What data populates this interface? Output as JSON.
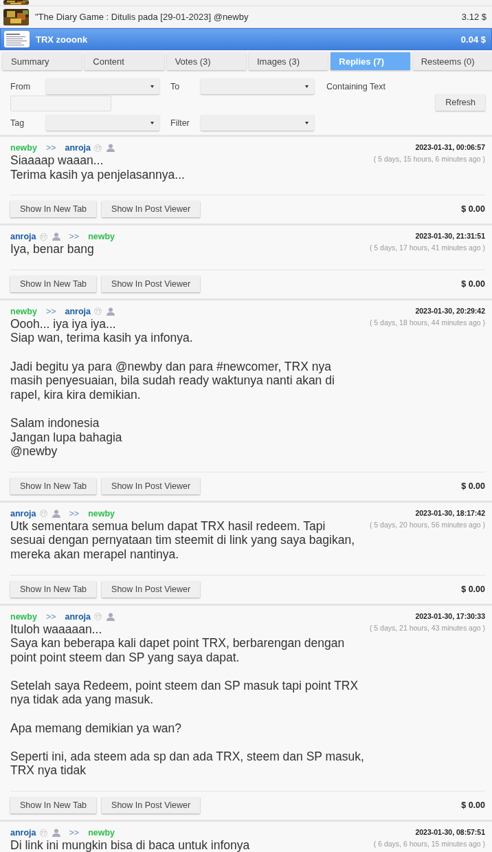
{
  "posts": [
    {
      "selected": false
    },
    {
      "title": "\"The Diary Game : Ditulis pada [29-01-2023] @newby",
      "value": "3.12 $",
      "selected": false
    },
    {
      "title": "TRX zooonk",
      "value": "0.04 $",
      "selected": true
    }
  ],
  "tabs": [
    {
      "label": "Summary",
      "selected": false
    },
    {
      "label": "Content",
      "selected": false
    },
    {
      "label": "Votes (3)",
      "selected": false
    },
    {
      "label": "Images (3)",
      "selected": false
    },
    {
      "label": "Replies (7)",
      "selected": true
    },
    {
      "label": "Resteems (0)",
      "selected": false
    }
  ],
  "filters": {
    "from_label": "From",
    "to_label": "To",
    "text_label": "Containing Text",
    "refresh": "Refresh",
    "tag_label": "Tag",
    "filter_label": "Filter"
  },
  "replies": [
    {
      "from": {
        "name": "newby",
        "color": "#2ebc4f"
      },
      "arrow": ">>",
      "to": {
        "name": "anroja",
        "color": "#1a5ba6",
        "reputation": "77"
      },
      "date": "2023-01-31, 00:06:57",
      "ago": "( 5 days, 15 hours, 6 minutes ago )",
      "body": "Siaaaap waaan...\nTerima kasih ya penjelasannya...",
      "buttons": [
        "Show In New Tab",
        "Show In Post Viewer"
      ],
      "value": "$ 0.00"
    },
    {
      "from": {
        "name": "anroja",
        "color": "#1a5ba6",
        "reputation": "77"
      },
      "arrow": ">>",
      "to": {
        "name": "newby",
        "color": "#2ebc4f"
      },
      "date": "2023-01-30, 21:31:51",
      "ago": "( 5 days, 17 hours, 41 minutes ago )",
      "body": "Iya, benar bang",
      "buttons": [
        "Show In New Tab",
        "Show In Post Viewer"
      ],
      "value": "$ 0.00"
    },
    {
      "from": {
        "name": "newby",
        "color": "#2ebc4f"
      },
      "arrow": ">>",
      "to": {
        "name": "anroja",
        "color": "#1a5ba6",
        "reputation": "77"
      },
      "date": "2023-01-30, 20:29:42",
      "ago": "( 5 days, 18 hours, 44 minutes ago )",
      "body": "Oooh... iya iya iya...\nSiap wan, terima kasih ya infonya.\n\nJadi begitu ya para @newby dan para #newcomer, TRX nya\nmasih penyesuaian, bila sudah ready waktunya nanti akan di\nrapel, kira kira demikian.\n\nSalam indonesia\nJangan lupa bahagia\n@newby",
      "buttons": [
        "Show In New Tab",
        "Show In Post Viewer"
      ],
      "value": "$ 0.00"
    },
    {
      "from": {
        "name": "anroja",
        "color": "#1a5ba6",
        "reputation": "77"
      },
      "arrow": ">>",
      "to": {
        "name": "newby",
        "color": "#2ebc4f"
      },
      "date": "2023-01-30, 18:17:42",
      "ago": "( 5 days, 20 hours, 56 minutes ago )",
      "body": "Utk sementara semua belum dapat TRX hasil redeem. Tapi\nsesuai dengan pernyataan tim steemit di link yang saya bagikan,\nmereka akan merapel nantinya.",
      "buttons": [
        "Show In New Tab",
        "Show In Post Viewer"
      ],
      "value": "$ 0.00"
    },
    {
      "from": {
        "name": "newby",
        "color": "#2ebc4f"
      },
      "arrow": ">>",
      "to": {
        "name": "anroja",
        "color": "#1a5ba6",
        "reputation": "77"
      },
      "date": "2023-01-30, 17:30:33",
      "ago": "( 5 days, 21 hours, 43 minutes ago )",
      "body": "Ituloh waaaaan...\nSaya kan beberapa kali dapet point TRX, berbarengan dengan\npoint point steem dan SP yang saya dapat.\n\nSetelah saya Redeem, point steem dan SP masuk tapi point TRX\nnya tidak ada yang masuk.\n\nApa memang demikian ya wan?\n\nSeperti ini, ada steem ada sp dan ada TRX, steem dan SP masuk,\nTRX nya tidak",
      "buttons": [
        "Show In New Tab",
        "Show In Post Viewer"
      ],
      "value": "$ 0.00"
    },
    {
      "from": {
        "name": "anroja",
        "color": "#1a5ba6",
        "reputation": "77"
      },
      "arrow": ">>",
      "to": {
        "name": "newby",
        "color": "#2ebc4f"
      },
      "date": "2023-01-30, 08:57:51",
      "ago": "( 6 days, 6 hours, 15 minutes ago )",
      "body": "Di link ini mungkin bisa di baca untuk infonya"
    }
  ]
}
